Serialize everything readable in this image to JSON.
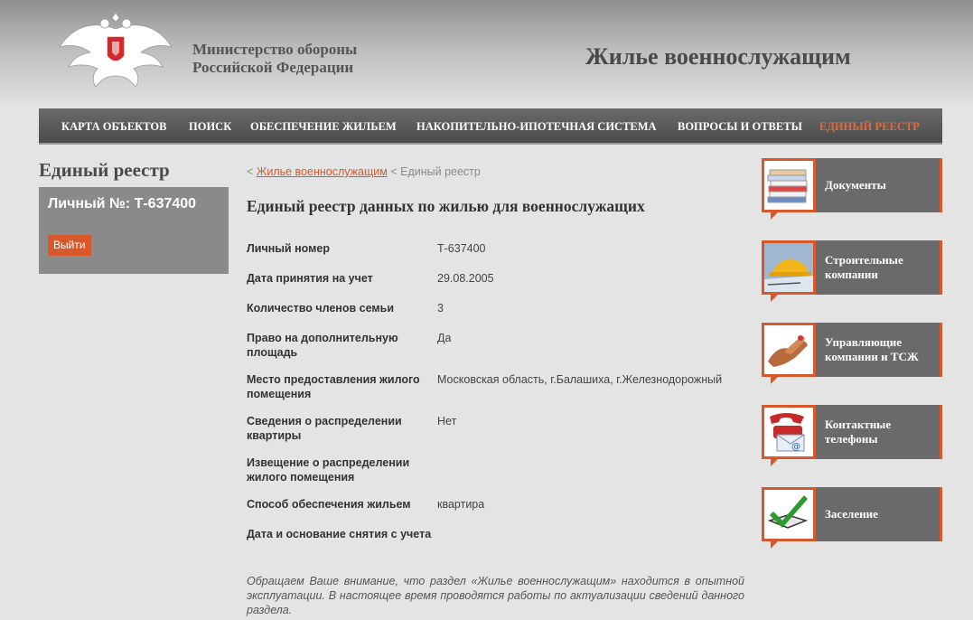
{
  "header": {
    "ministry_line1": "Министерство обороны",
    "ministry_line2": "Российской Федерации",
    "site_title": "Жилье военнослужащим",
    "emblem_icon": "double-headed-eagle-emblem"
  },
  "nav": {
    "items": [
      {
        "label": "КАРТА ОБЪЕКТОВ"
      },
      {
        "label": "ПОИСК"
      },
      {
        "label": "ОБЕСПЕЧЕНИЕ ЖИЛЬЕМ"
      },
      {
        "label": "НАКОПИТЕЛЬНО-ИПОТЕЧНАЯ СИСТЕМА"
      },
      {
        "label": "ВОПРОСЫ И ОТВЕТЫ"
      },
      {
        "label": "ЕДИНЫЙ РЕЕСТР"
      }
    ],
    "active_color": "#e26a3a"
  },
  "sidebar_left": {
    "title": "Единый реестр",
    "personal_number": "Личный №: Т-637400",
    "logout_label": "Выйти"
  },
  "breadcrumb": {
    "sep1": "<",
    "link": "Жилье военнослужащим",
    "sep2": "<",
    "current": "Единый реестр"
  },
  "main": {
    "title": "Единый реестр данных по жилью для военнослужащих",
    "fields": [
      {
        "label": "Личный номер",
        "value": "Т-637400"
      },
      {
        "label": "Дата принятия на учет",
        "value": "29.08.2005"
      },
      {
        "label": "Количество членов семьи",
        "value": "3"
      },
      {
        "label": "Право на дополнительную площадь",
        "value": "Да"
      },
      {
        "label": "Место предоставления жилого помещения",
        "value": "Московская область, г.Балашиха, г.Железнодорожный"
      },
      {
        "label": "Сведения о распределении квартиры",
        "value": "Нет"
      },
      {
        "label": "Извещение о распределении жилого помещения",
        "value": ""
      },
      {
        "label": "Способ обеспечения жильем",
        "value": "квартира"
      },
      {
        "label": "Дата и основание снятия с учета",
        "value": ""
      }
    ],
    "notice": "Обращаем Ваше внимание, что раздел «Жилье военнослужащим» находится в опытной эксплуатации. В настоящее время проводятся работы по актуализации сведений данного раздела."
  },
  "sidebar_right": {
    "items": [
      {
        "label": "Документы",
        "icon": "documents-stack-icon"
      },
      {
        "label": "Строительные компании",
        "icon": "construction-helmet-icon"
      },
      {
        "label": "Управляющие компании и ТСЖ",
        "icon": "handshake-icon"
      },
      {
        "label": "Контактные телефоны",
        "icon": "phone-email-icon"
      },
      {
        "label": "Заселение",
        "icon": "checkbox-checkmark-icon"
      }
    ],
    "accent_color": "#d9582b"
  }
}
